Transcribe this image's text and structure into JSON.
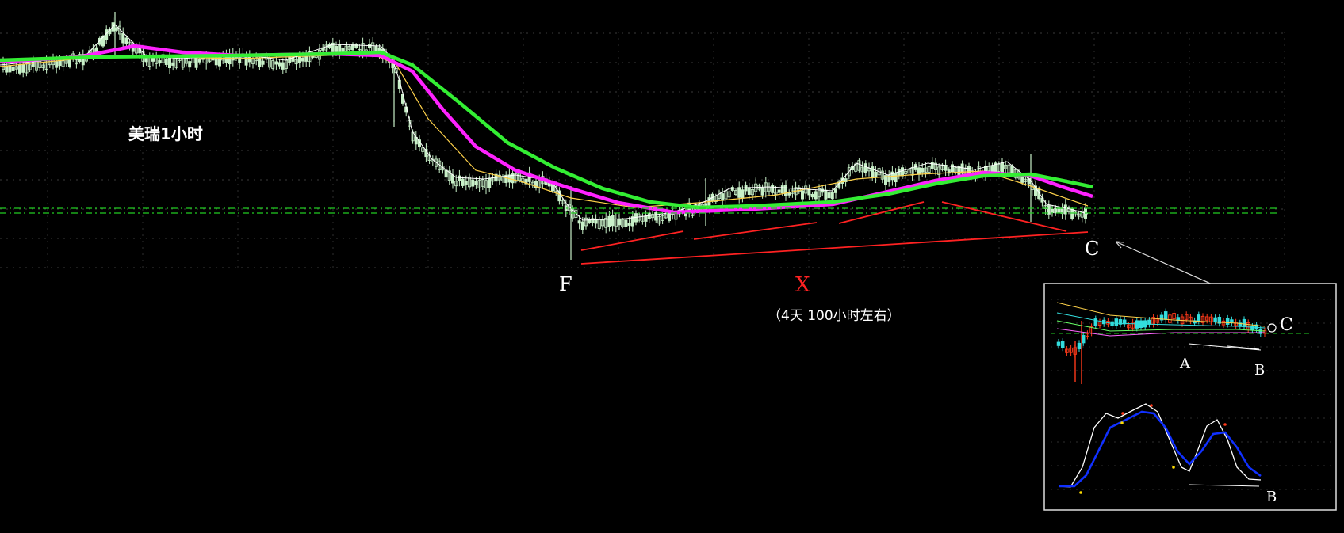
{
  "chart_data": {
    "type": "candlestick",
    "title": "美瑞1小时",
    "timeframe": "1小时",
    "annotation": "（4天 100小时左右）",
    "point_labels": {
      "F": "F",
      "X": "X",
      "C": "C"
    },
    "colors": {
      "background": "#000000",
      "candle": "#c8f0c8",
      "ma_fast": "#ffffff",
      "ma_slow": "#ffd24a",
      "ma_magenta": "#ff22ff",
      "ma_green": "#33ee33",
      "trendline": "#ff2222",
      "guide_dash": "#22cc22",
      "label": "#ffffff",
      "x_label": "#ff2222"
    },
    "inset": {
      "point_labels": {
        "A": "A",
        "B": "B",
        "B2": "B",
        "C": "C"
      },
      "colors": {
        "candle_up": "#ff3a1a",
        "candle_down": "#33dddd",
        "oscillator_fast": "#ffffff",
        "oscillator_slow": "#1030ff",
        "dots": "#ffdd00",
        "frame": "#dddddd",
        "divergence_line": "#ffffff"
      }
    }
  }
}
